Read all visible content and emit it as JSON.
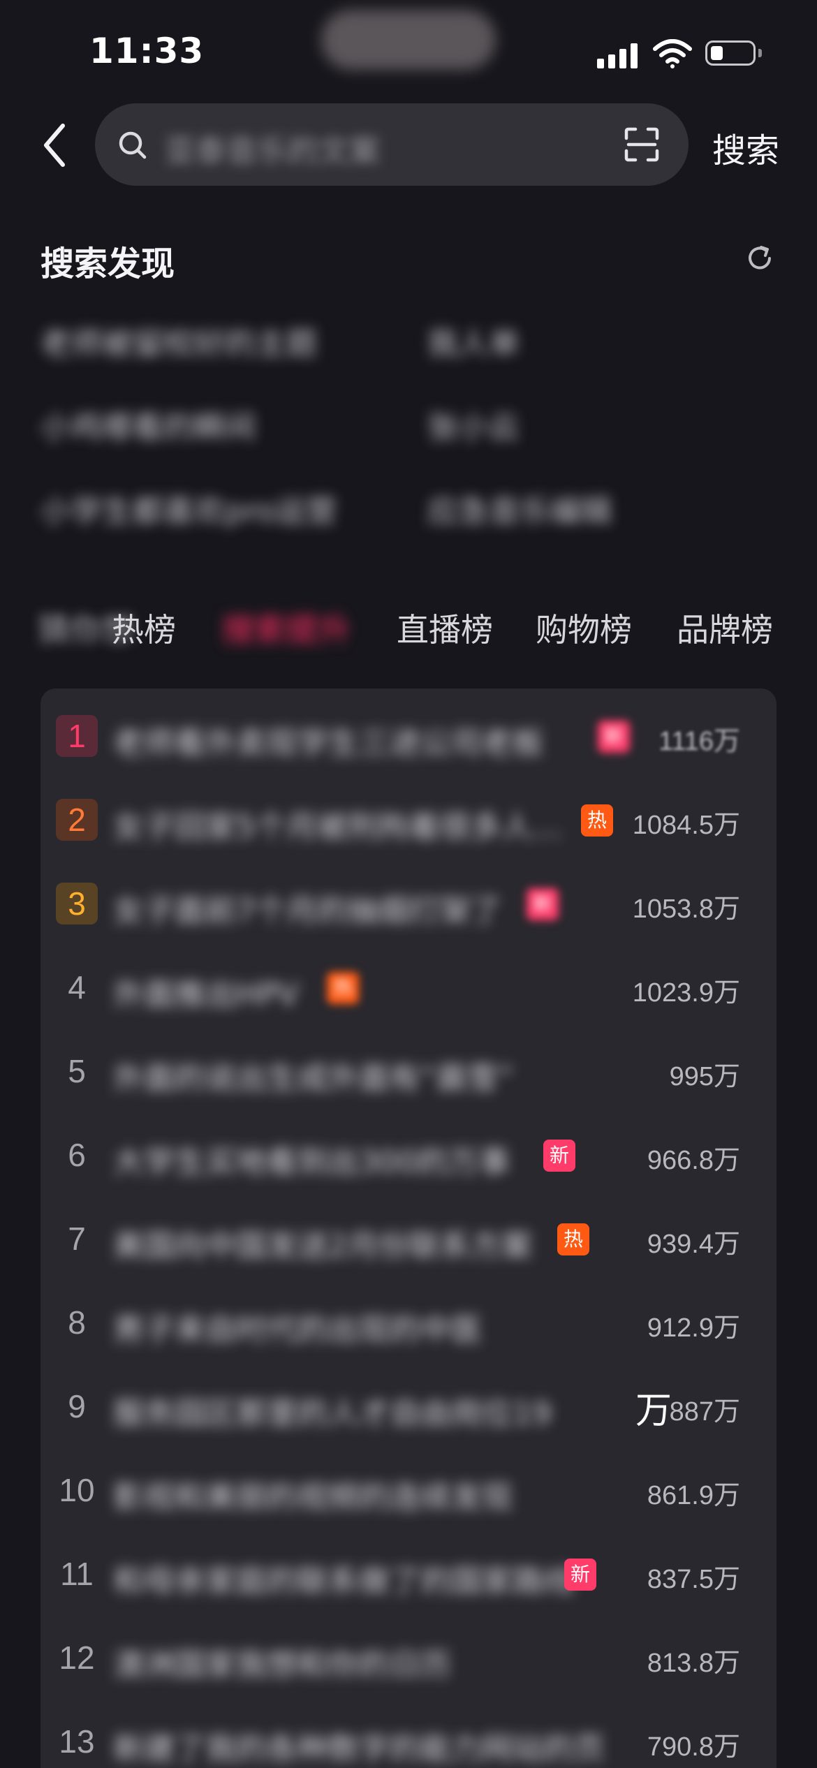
{
  "status_bar": {
    "time": "11:33",
    "battery_level": 0.3
  },
  "search": {
    "placeholder": "亚泰音乐的文案",
    "submit_label": "搜索"
  },
  "discovery": {
    "title": "搜索发现",
    "items": [
      "老师被留校好的主题",
      "我人单",
      "小鸡哪看的瞬间",
      "张小云",
      "小学生都喜欢pro运营",
      "应急音乐编辑"
    ]
  },
  "tabs": [
    {
      "label": "猜你想",
      "state": "blurred"
    },
    {
      "label": "热榜",
      "state": "normal"
    },
    {
      "label": "搜索提升",
      "state": "active"
    },
    {
      "label": "直播榜",
      "state": "normal"
    },
    {
      "label": "购物榜",
      "state": "normal"
    },
    {
      "label": "品牌榜",
      "state": "normal"
    }
  ],
  "hot_list": [
    {
      "rank": "1",
      "title": "老师看外卖现学生三进公司老板",
      "badge": "新",
      "badge_type": "new",
      "count": "1116万"
    },
    {
      "rank": "2",
      "title": "女子回家5个月被刑拘着很多人…",
      "badge": "热",
      "badge_type": "hot",
      "count": "1084.5万"
    },
    {
      "rank": "3",
      "title": "女子面前7个月的抽烟打架了",
      "badge": "新",
      "badge_type": "new",
      "count": "1053.8万"
    },
    {
      "rank": "4",
      "title": "外面推出HPV",
      "badge": "热",
      "badge_type": "hot",
      "count": "1023.9万"
    },
    {
      "rank": "5",
      "title": "外面的说出生成外面有“晨雪”",
      "badge": "",
      "badge_type": "",
      "count": "995万"
    },
    {
      "rank": "6",
      "title": "大学生买地看到出300的万事",
      "badge": "新",
      "badge_type": "new",
      "count": "966.8万"
    },
    {
      "rank": "7",
      "title": "美国向中国发送2月份联系方案",
      "badge": "热",
      "badge_type": "hot",
      "count": "939.4万"
    },
    {
      "rank": "8",
      "title": "男子来自时代的出现的中医",
      "badge": "",
      "badge_type": "",
      "count": "912.9万"
    },
    {
      "rank": "9",
      "title": "服务园区那里的人才自由岗位19",
      "badge": "",
      "badge_type": "",
      "count": "887万"
    },
    {
      "rank": "10",
      "title": "影视和美丽的视频的连续发现",
      "badge": "",
      "badge_type": "",
      "count": "861.9万"
    },
    {
      "rank": "11",
      "title": "和母亲家庭的联系做了的国家路线",
      "badge": "新",
      "badge_type": "new",
      "count": "837.5万"
    },
    {
      "rank": "12",
      "title": "澳洲国家我想和你的日历",
      "badge": "",
      "badge_type": "",
      "count": "813.8万"
    },
    {
      "rank": "13",
      "title": "新建了我的各种数字的能力网站的页",
      "badge": "",
      "badge_type": "",
      "count": "790.8万"
    }
  ],
  "overlay_text": "万"
}
